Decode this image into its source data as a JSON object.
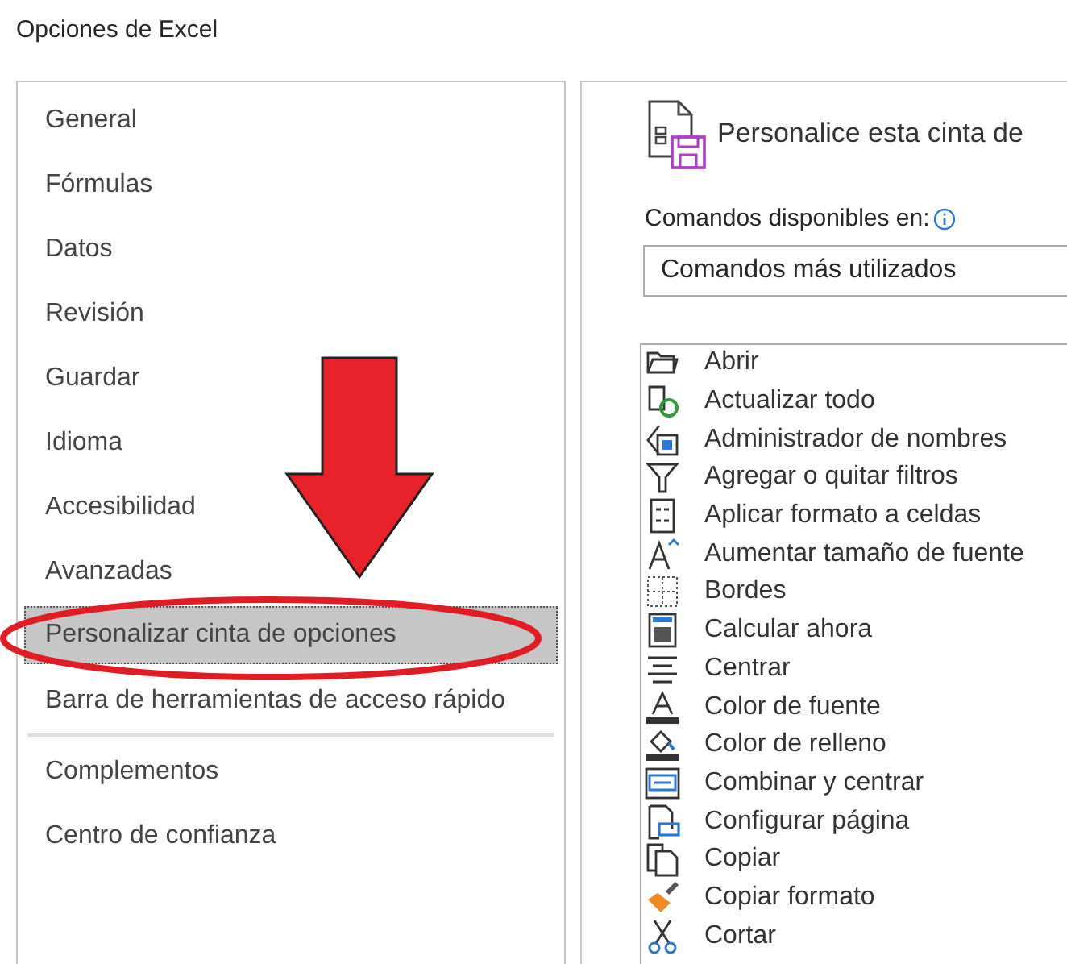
{
  "window": {
    "title": "Opciones de Excel"
  },
  "sidebar": {
    "items": [
      {
        "label": "General",
        "selected": false,
        "separator_after": false
      },
      {
        "label": "Fórmulas",
        "selected": false,
        "separator_after": false
      },
      {
        "label": "Datos",
        "selected": false,
        "separator_after": false
      },
      {
        "label": "Revisión",
        "selected": false,
        "separator_after": false
      },
      {
        "label": "Guardar",
        "selected": false,
        "separator_after": false
      },
      {
        "label": "Idioma",
        "selected": false,
        "separator_after": false
      },
      {
        "label": "Accesibilidad",
        "selected": false,
        "separator_after": false
      },
      {
        "label": "Avanzadas",
        "selected": false,
        "separator_after": false
      },
      {
        "label": "Personalizar cinta de opciones",
        "selected": true,
        "separator_after": false
      },
      {
        "label": "Barra de herramientas de acceso rápido",
        "selected": false,
        "separator_after": true
      },
      {
        "label": "Complementos",
        "selected": false,
        "separator_after": false
      },
      {
        "label": "Centro de confianza",
        "selected": false,
        "separator_after": false
      }
    ]
  },
  "main": {
    "heading": "Personalice esta cinta de",
    "commands_label": "Comandos disponibles en:",
    "commands_source": "Comandos más utilizados",
    "commands": [
      {
        "label": "Abrir"
      },
      {
        "label": "Actualizar todo"
      },
      {
        "label": "Administrador de nombres"
      },
      {
        "label": "Agregar o quitar filtros"
      },
      {
        "label": "Aplicar formato a celdas"
      },
      {
        "label": "Aumentar tamaño de fuente"
      },
      {
        "label": "Bordes"
      },
      {
        "label": "Calcular ahora"
      },
      {
        "label": "Centrar"
      },
      {
        "label": "Color de fuente"
      },
      {
        "label": "Color de relleno"
      },
      {
        "label": "Combinar y centrar"
      },
      {
        "label": "Configurar página"
      },
      {
        "label": "Copiar"
      },
      {
        "label": "Copiar formato"
      },
      {
        "label": "Cortar"
      }
    ]
  },
  "annotations": {
    "arrow": true,
    "ellipse": true
  }
}
